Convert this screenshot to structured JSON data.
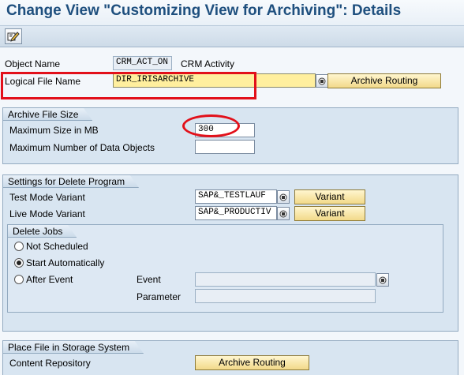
{
  "window": {
    "title": "Change View \"Customizing View for Archiving\": Details"
  },
  "toolbar": {
    "edit_icon": "display-change-icon"
  },
  "header": {
    "object_name_label": "Object Name",
    "object_name_value": "CRM_ACT_ON",
    "object_name_desc": "CRM Activity",
    "logical_file_label": "Logical File Name",
    "logical_file_value": "DIR_IRISARCHIVE",
    "archive_routing_label": "Archive Routing"
  },
  "archive_file_size": {
    "title": "Archive File Size",
    "max_size_label": "Maximum Size in MB",
    "max_size_value": "300",
    "max_objects_label": "Maximum Number of Data Objects",
    "max_objects_value": ""
  },
  "delete_program": {
    "title": "Settings for Delete Program",
    "test_mode_label": "Test Mode Variant",
    "test_mode_value": "SAP&_TESTLAUF",
    "live_mode_label": "Live Mode Variant",
    "live_mode_value": "SAP&_PRODUCTIV",
    "variant_button": "Variant",
    "delete_jobs": {
      "title": "Delete Jobs",
      "options": [
        "Not Scheduled",
        "Start Automatically",
        "After Event"
      ],
      "selected": "Start Automatically",
      "event_label": "Event",
      "event_value": "",
      "parameter_label": "Parameter",
      "parameter_value": ""
    }
  },
  "storage": {
    "title": "Place File in Storage System",
    "content_repo_label": "Content Repository",
    "archive_routing_label": "Archive Routing"
  },
  "annotations": {
    "color": "#e2101a"
  },
  "colors": {
    "title": "#1e4f7e",
    "required_field": "#ffef9e",
    "button": "#f2d98a"
  }
}
